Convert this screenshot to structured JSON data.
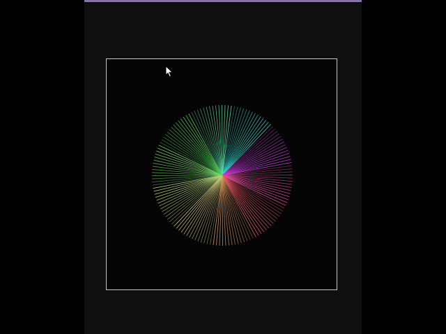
{
  "window": {
    "accent_color": "#8a72a6",
    "background_color": "#0f0f0f",
    "frame_border_color": "#c8c8c8"
  },
  "artwork": {
    "kind": "radial-line-color-wheel",
    "segments": [
      {
        "color": "#2fd3c8"
      },
      {
        "color": "#c23ad8"
      },
      {
        "color": "#e04aa0"
      },
      {
        "color": "#e85a6a"
      },
      {
        "color": "#d7945a"
      },
      {
        "color": "#cbc27a"
      },
      {
        "color": "#b7d47a"
      },
      {
        "color": "#7ad870"
      },
      {
        "color": "#4ecf5a"
      },
      {
        "color": "#5ad6a0"
      }
    ]
  },
  "cursor": {
    "icon": "mouse-pointer-icon"
  }
}
